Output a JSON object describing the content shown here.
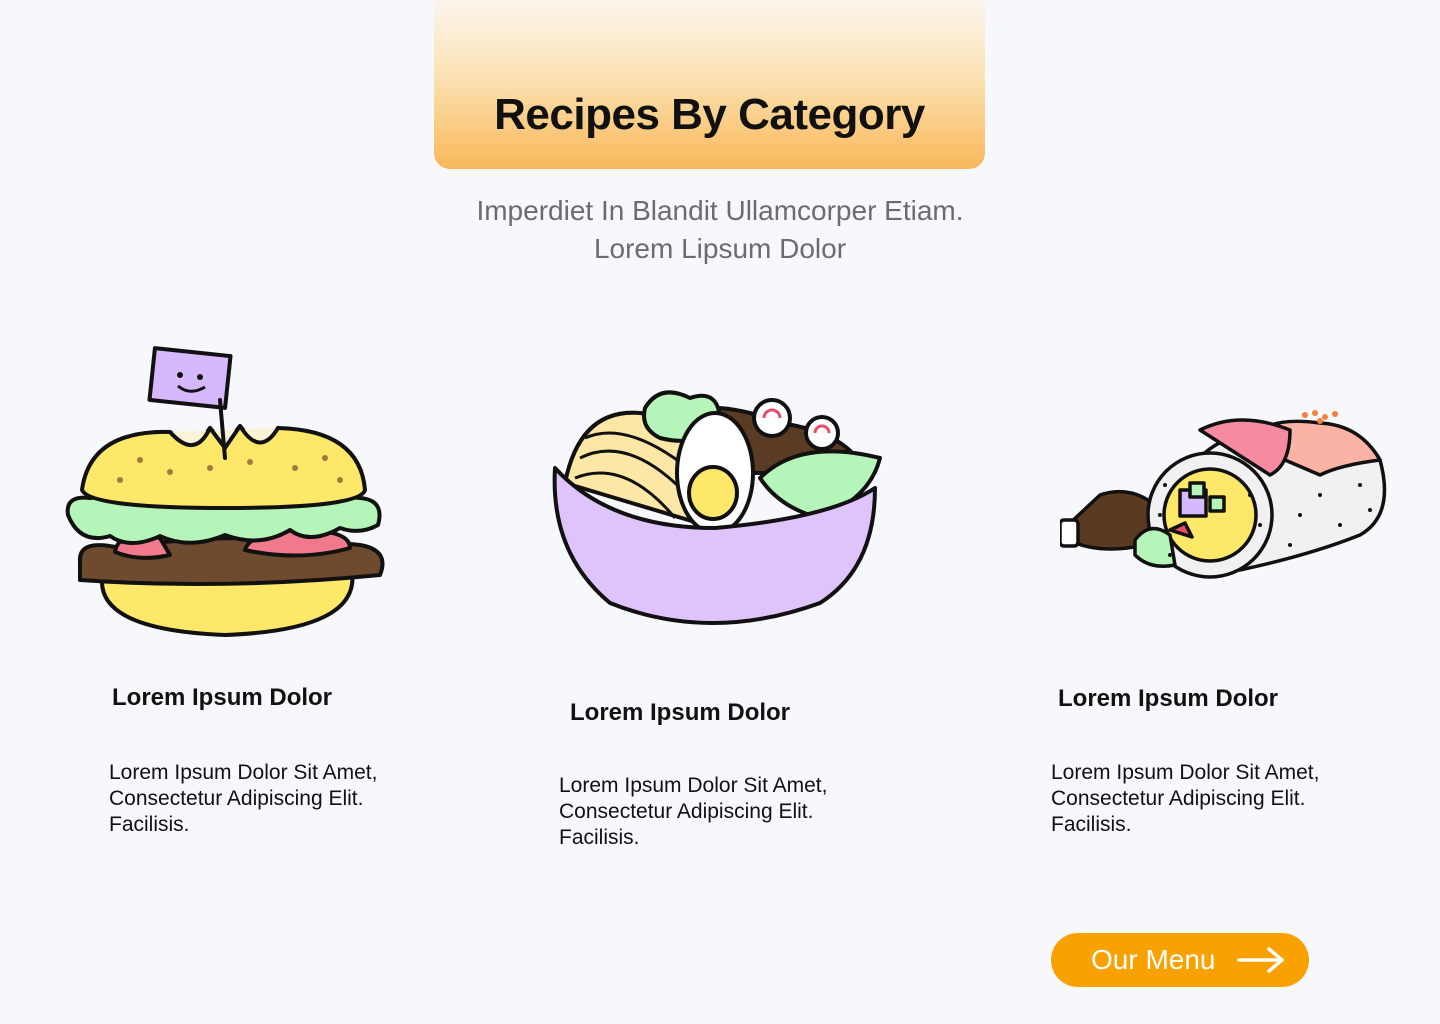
{
  "header": {
    "title": "Recipes By Category"
  },
  "intro": {
    "line1": "Imperdiet In Blandit Ullamcorper Etiam.",
    "line2": "Lorem Lipsum Dolor"
  },
  "categories": [
    {
      "icon": "burger-illustration",
      "title": "Lorem Ipsum Dolor",
      "desc": [
        "Lorem Ipsum Dolor Sit Amet,",
        "Consectetur Adipiscing Elit.",
        "Facilisis."
      ]
    },
    {
      "icon": "ramen-bowl-illustration",
      "title": "Lorem Ipsum Dolor",
      "desc": [
        "Lorem Ipsum Dolor Sit Amet,",
        "Consectetur Adipiscing Elit.",
        "Facilisis."
      ]
    },
    {
      "icon": "sushi-roll-illustration",
      "title": "Lorem Ipsum Dolor",
      "desc": [
        "Lorem Ipsum Dolor Sit Amet,",
        "Consectetur Adipiscing Elit.",
        "Facilisis."
      ]
    }
  ],
  "cta": {
    "label": "Our Menu",
    "icon": "arrow-right-icon"
  },
  "colors": {
    "background": "#f7f8fc",
    "accent": "#f9a100",
    "banner_top": "#fbf5ee",
    "banner_bottom": "#f9b85a",
    "subtitle": "#6b6b73"
  }
}
